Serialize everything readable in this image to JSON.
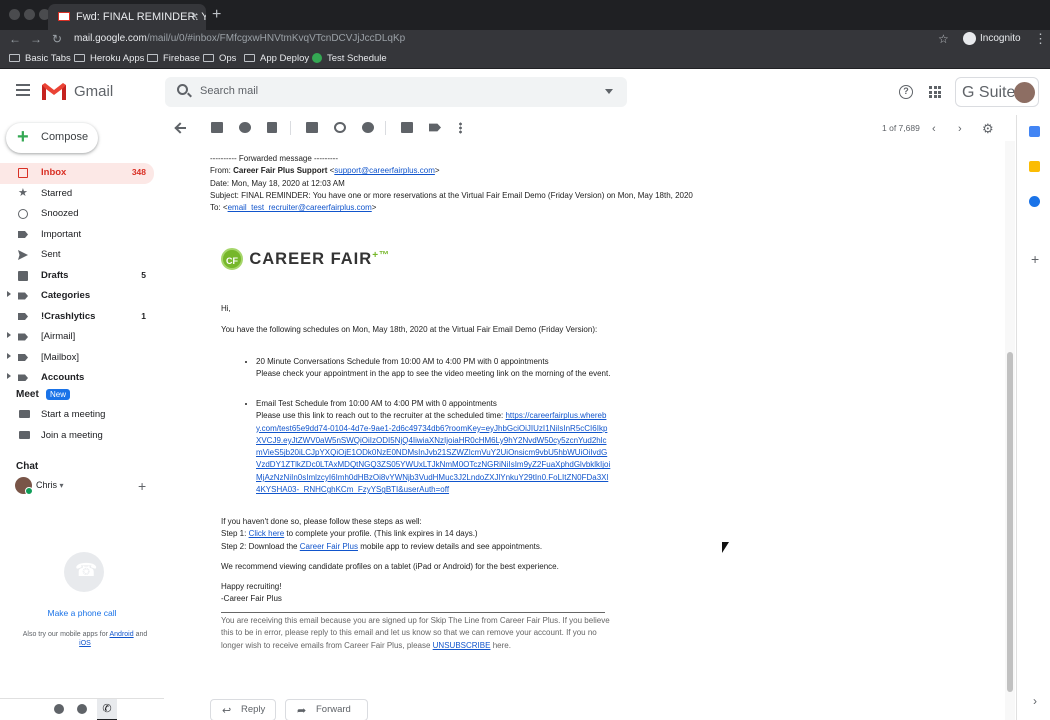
{
  "browser": {
    "tab_title": "Fwd: FINAL REMINDER: You ha",
    "tab_close": "×",
    "new_tab": "+",
    "url_host": "mail.google.com",
    "url_path": "/mail/u/0/#inbox/FMfcgxwHNVtmKvqVTcnDCVJjJccDLqKp",
    "nav_back": "←",
    "nav_forward": "→",
    "reload": "↻",
    "star": "☆",
    "incognito_label": "Incognito",
    "menu": "⋮",
    "bookmarks": [
      "Basic Tabs",
      "Heroku Apps",
      "Firebase",
      "Ops",
      "App Deploy",
      "Test Schedule"
    ]
  },
  "header": {
    "brand": "Gmail",
    "search_placeholder": "Search mail",
    "help": "?",
    "suite_label": "G Suite"
  },
  "sidebar": {
    "compose_label": "Compose",
    "compose_plus": "+",
    "items": [
      {
        "label": "Inbox",
        "count": "348"
      },
      {
        "label": "Starred",
        "count": ""
      },
      {
        "label": "Snoozed",
        "count": ""
      },
      {
        "label": "Important",
        "count": ""
      },
      {
        "label": "Sent",
        "count": ""
      },
      {
        "label": "Drafts",
        "count": "5"
      },
      {
        "label": "Categories",
        "count": ""
      },
      {
        "label": "!Crashlytics",
        "count": "1"
      },
      {
        "label": "[Airmail]",
        "count": ""
      },
      {
        "label": "[Mailbox]",
        "count": ""
      },
      {
        "label": "Accounts",
        "count": ""
      }
    ],
    "meet": {
      "heading": "Meet",
      "badge": "New",
      "start": "Start a meeting",
      "join": "Join a meeting"
    },
    "chat": {
      "heading": "Chat",
      "user": "Chris",
      "user_caret": "▾",
      "add": "+",
      "phone_link": "Make a phone call",
      "note_prefix": "Also try our mobile apps for",
      "note_android": "Android",
      "note_and": "and",
      "note_ios": "iOS"
    },
    "bottom_phone": "✆"
  },
  "toolbar": {
    "pager": "1 of 7,689",
    "prev": "‹",
    "next": "›",
    "settings": "⚙"
  },
  "email": {
    "fwd_header": "---------- Forwarded message ---------",
    "from_label": "From:",
    "from_name": "Career Fair Plus Support",
    "from_email": "support@careerfairplus.com",
    "date": "Date: Mon, May 18, 2020 at 12:03 AM",
    "subject": "Subject: FINAL REMINDER: You have one or more reservations at the Virtual Fair Email Demo (Friday Version) on Mon, May 18th, 2020",
    "to_label": "To:",
    "to_email": "email_test_recruiter@careerfairplus.com",
    "logo_badge": "CF",
    "logo_text": "CAREER FAIR",
    "logo_sup": "+™",
    "greeting": "Hi,",
    "intro": "You have the following schedules on Mon, May 18th, 2020 at the Virtual Fair Email Demo (Friday Version):",
    "schedule1_title": "20 Minute Conversations Schedule from 10:00 AM to 4:00 PM with 0 appointments",
    "schedule1_note": "Please check your appointment in the app to see the video meeting link on the morning of the event.",
    "schedule2_title": "Email Test Schedule from 10:00 AM to 4:00 PM with 0 appointments",
    "schedule2_note": "Please use this link to reach out to the recruiter at the scheduled time:",
    "schedule2_link": "https://careerfairplus.whereby.com/test65e9dd74-0104-4d7e-9ae1-2d6c49734db6?roomKey=eyJhbGciOiJIUzI1NiIsInR5cCI6IkpXVCJ9.eyJtZWV0aW5nSWQiOiIzODI5NjQ4IiwiaXNzIjoiaHR0cHM6Ly9hY2NvdW50cy5zcnYud2hlcmVieS5jb20iLCJpYXQiOjE1ODk0NzE0NDMsInJvb21SZWZlcmVuY2UiOnsicm9vbU5hbWUiOiIvdGVzdDY1ZTlkZDc0LTAxMDQtNGQ3ZS05YWUxLTJkNmM0OTczNGRiNiIsIm9yZ2FuaXphdGlvbklkIjoiMjAzNzNiIn0sImlzcyI6Imh0dHBzOi8vYWNjb3VudHMuc3J2LndoZXJlYnkuY29tIn0.FoLItZN0FDa3Xl4KYSHA03-_RNHCghKCm_FzyYSgBTI&userAuth=off",
    "steps_intro": "If you haven't done so, please follow these steps as well:",
    "step1_prefix": "Step 1:",
    "step1_link": "Click here",
    "step1_suffix": "to complete your profile. (This link expires in 14 days.)",
    "step2_prefix": "Step 2: Download the",
    "step2_link": "Career Fair Plus",
    "step2_suffix": "mobile app to review details and see appointments.",
    "recommend": "We recommend viewing candidate profiles on a tablet (iPad or Android) for the best experience.",
    "signoff1": "Happy recruiting!",
    "signoff2": "-Career Fair Plus",
    "footer_text": "You are receiving this email because you are signed up for Skip The Line from Career Fair Plus. If you believe this to be in error, please reply to this email and let us know so that we can remove your account. If you no longer wish to receive emails from Career Fair Plus, please",
    "footer_link": "UNSUBSCRIBE",
    "footer_end": "here."
  },
  "actions": {
    "reply": "Reply",
    "reply_icon": "↩",
    "forward": "Forward",
    "forward_icon": "➦"
  },
  "sidepanel": {
    "add": "+",
    "expand": "›"
  }
}
